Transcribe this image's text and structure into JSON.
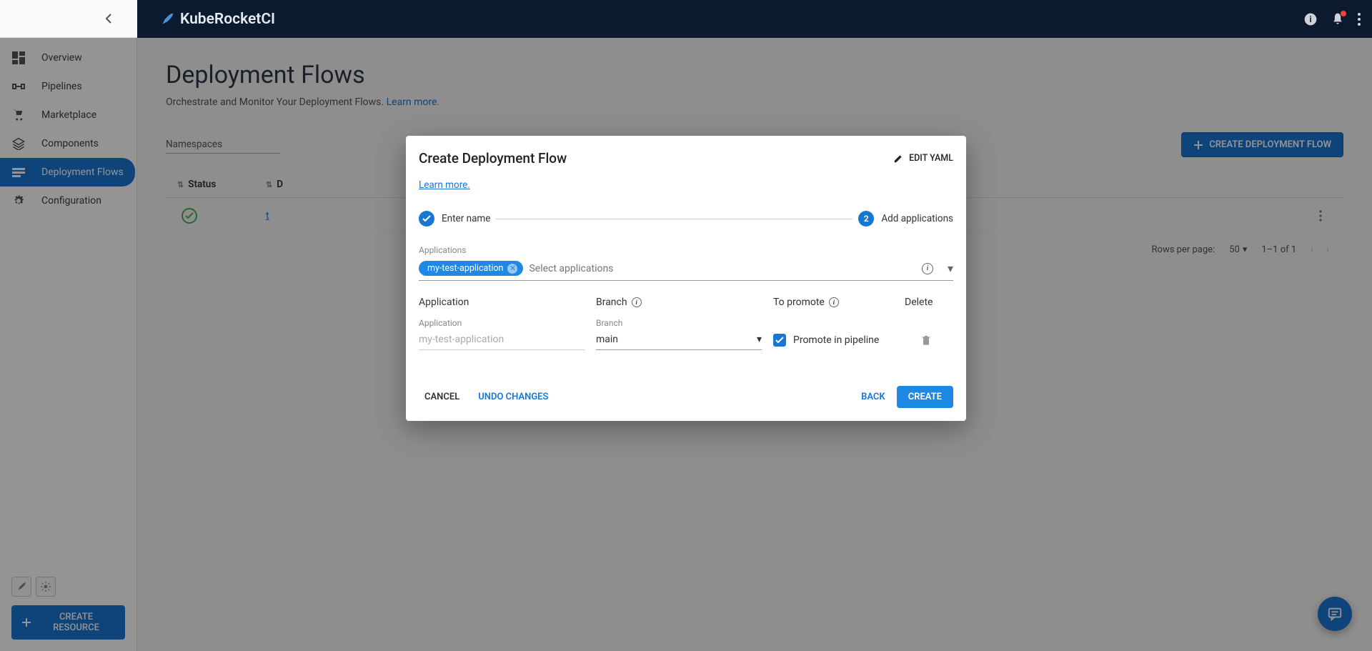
{
  "brand": "KubeRocketCI",
  "sidebar": {
    "items": [
      {
        "label": "Overview"
      },
      {
        "label": "Pipelines"
      },
      {
        "label": "Marketplace"
      },
      {
        "label": "Components"
      },
      {
        "label": "Deployment Flows"
      },
      {
        "label": "Configuration"
      }
    ],
    "create_resource": "CREATE RESOURCE"
  },
  "page": {
    "title": "Deployment Flows",
    "subtitle": "Orchestrate and Monitor Your Deployment Flows.",
    "learn_more": "Learn more."
  },
  "toolbar": {
    "namespaces": "Namespaces",
    "create_button": "CREATE DEPLOYMENT FLOW"
  },
  "table": {
    "headers": {
      "status": "Status",
      "d": "D"
    },
    "row": {
      "name_prefix": "t"
    },
    "footer": {
      "rpp_label": "Rows per page:",
      "rpp_value": "50",
      "range": "1–1 of 1"
    }
  },
  "modal": {
    "title": "Create Deployment Flow",
    "edit_yaml": "EDIT YAML",
    "learn_more": "Learn more.",
    "steps": {
      "s1": "Enter name",
      "s2_num": "2",
      "s2": "Add applications"
    },
    "apps_label": "Applications",
    "chip": "my-test-application",
    "apps_placeholder": "Select applications",
    "grid": {
      "h_app": "Application",
      "h_branch": "Branch",
      "h_promote": "To promote",
      "h_delete": "Delete",
      "l_app": "Application",
      "l_branch": "Branch",
      "app_value": "my-test-application",
      "branch_value": "main",
      "promote_label": "Promote in pipeline"
    },
    "footer": {
      "cancel": "CANCEL",
      "undo": "UNDO CHANGES",
      "back": "BACK",
      "create": "CREATE"
    }
  }
}
